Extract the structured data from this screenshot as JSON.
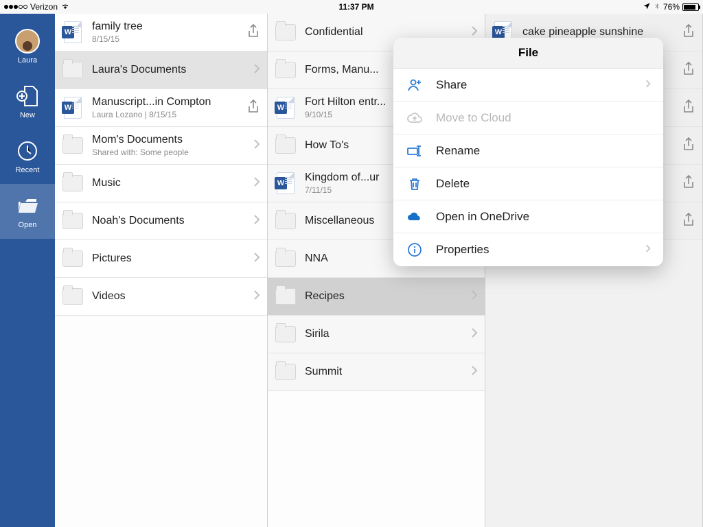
{
  "statusbar": {
    "carrier": "Verizon",
    "time": "11:37 PM",
    "battery_pct": "76%"
  },
  "sidebar": {
    "user": "Laura",
    "items": [
      {
        "label": "New"
      },
      {
        "label": "Recent"
      },
      {
        "label": "Open"
      }
    ]
  },
  "col1": [
    {
      "type": "doc",
      "title": "family tree",
      "sub": "8/15/15",
      "action": "share"
    },
    {
      "type": "folder",
      "title": "Laura's Documents",
      "selected": true,
      "action": "chev"
    },
    {
      "type": "doc",
      "title": "Manuscript...in Compton",
      "sub": "Laura Lozano | 8/15/15",
      "action": "share"
    },
    {
      "type": "folder",
      "title": "Mom's Documents",
      "sub": "Shared with: Some people",
      "action": "chev"
    },
    {
      "type": "folder",
      "title": "Music",
      "action": "chev"
    },
    {
      "type": "folder",
      "title": "Noah's Documents",
      "action": "chev"
    },
    {
      "type": "folder",
      "title": "Pictures",
      "action": "chev"
    },
    {
      "type": "folder",
      "title": "Videos",
      "action": "chev"
    }
  ],
  "col2": [
    {
      "type": "folder",
      "title": "Confidential",
      "action": "chev"
    },
    {
      "type": "folder",
      "title": "Forms, Manu...",
      "action": "chev"
    },
    {
      "type": "doc",
      "title": "Fort Hilton entr...",
      "sub": "9/10/15"
    },
    {
      "type": "folder",
      "title": "How To's",
      "action": "chev"
    },
    {
      "type": "doc",
      "title": "Kingdom of...ur",
      "sub": "7/11/15"
    },
    {
      "type": "folder",
      "title": "Miscellaneous",
      "action": "chev"
    },
    {
      "type": "folder",
      "title": "NNA",
      "action": "chev"
    },
    {
      "type": "folder",
      "title": "Recipes",
      "selected": true,
      "action": "chev"
    },
    {
      "type": "folder",
      "title": "Sirila",
      "action": "chev"
    },
    {
      "type": "folder",
      "title": "Summit",
      "action": "chev"
    }
  ],
  "col3": [
    {
      "type": "doc",
      "title": "cake pineapple sunshine",
      "action": "share"
    },
    {
      "type": "blank",
      "action": "share"
    },
    {
      "type": "blank",
      "action": "share"
    },
    {
      "type": "blank",
      "action": "share"
    },
    {
      "type": "blank",
      "action": "share"
    },
    {
      "type": "blank",
      "action": "share"
    }
  ],
  "popover": {
    "title": "File",
    "items": [
      {
        "label": "Share",
        "icon": "share-person",
        "chev": true
      },
      {
        "label": "Move to Cloud",
        "icon": "cloud-up",
        "disabled": true
      },
      {
        "label": "Rename",
        "icon": "rename"
      },
      {
        "label": "Delete",
        "icon": "trash"
      },
      {
        "label": "Open in OneDrive",
        "icon": "onedrive"
      },
      {
        "label": "Properties",
        "icon": "info",
        "chev": true
      }
    ]
  }
}
